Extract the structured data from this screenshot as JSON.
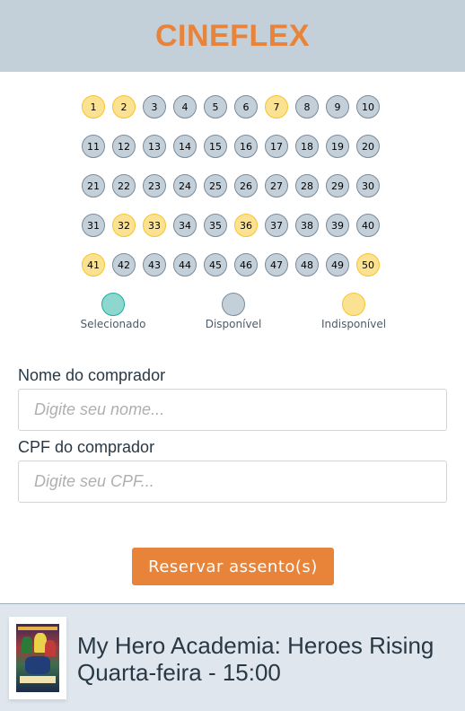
{
  "header": {
    "title": "CINEFLEX"
  },
  "seats": [
    {
      "number": "1",
      "status": "unavailable"
    },
    {
      "number": "2",
      "status": "unavailable"
    },
    {
      "number": "3",
      "status": "available"
    },
    {
      "number": "4",
      "status": "available"
    },
    {
      "number": "5",
      "status": "available"
    },
    {
      "number": "6",
      "status": "available"
    },
    {
      "number": "7",
      "status": "unavailable"
    },
    {
      "number": "8",
      "status": "available"
    },
    {
      "number": "9",
      "status": "available"
    },
    {
      "number": "10",
      "status": "available"
    },
    {
      "number": "11",
      "status": "available"
    },
    {
      "number": "12",
      "status": "available"
    },
    {
      "number": "13",
      "status": "available"
    },
    {
      "number": "14",
      "status": "available"
    },
    {
      "number": "15",
      "status": "available"
    },
    {
      "number": "16",
      "status": "available"
    },
    {
      "number": "17",
      "status": "available"
    },
    {
      "number": "18",
      "status": "available"
    },
    {
      "number": "19",
      "status": "available"
    },
    {
      "number": "20",
      "status": "available"
    },
    {
      "number": "21",
      "status": "available"
    },
    {
      "number": "22",
      "status": "available"
    },
    {
      "number": "23",
      "status": "available"
    },
    {
      "number": "24",
      "status": "available"
    },
    {
      "number": "25",
      "status": "available"
    },
    {
      "number": "26",
      "status": "available"
    },
    {
      "number": "27",
      "status": "available"
    },
    {
      "number": "28",
      "status": "available"
    },
    {
      "number": "29",
      "status": "available"
    },
    {
      "number": "30",
      "status": "available"
    },
    {
      "number": "31",
      "status": "available"
    },
    {
      "number": "32",
      "status": "unavailable"
    },
    {
      "number": "33",
      "status": "unavailable"
    },
    {
      "number": "34",
      "status": "available"
    },
    {
      "number": "35",
      "status": "available"
    },
    {
      "number": "36",
      "status": "unavailable"
    },
    {
      "number": "37",
      "status": "available"
    },
    {
      "number": "38",
      "status": "available"
    },
    {
      "number": "39",
      "status": "available"
    },
    {
      "number": "40",
      "status": "available"
    },
    {
      "number": "41",
      "status": "unavailable"
    },
    {
      "number": "42",
      "status": "available"
    },
    {
      "number": "43",
      "status": "available"
    },
    {
      "number": "44",
      "status": "available"
    },
    {
      "number": "45",
      "status": "available"
    },
    {
      "number": "46",
      "status": "available"
    },
    {
      "number": "47",
      "status": "available"
    },
    {
      "number": "48",
      "status": "available"
    },
    {
      "number": "49",
      "status": "available"
    },
    {
      "number": "50",
      "status": "unavailable"
    }
  ],
  "legend": {
    "selected": "Selecionado",
    "available": "Disponível",
    "unavailable": "Indisponível"
  },
  "form": {
    "name_label": "Nome do comprador",
    "name_placeholder": "Digite seu nome...",
    "cpf_label": "CPF do comprador",
    "cpf_placeholder": "Digite seu CPF...",
    "submit_label": "Reservar assento(s)"
  },
  "footer": {
    "movie_title": "My Hero Academia: Heroes Rising",
    "session": "Quarta-feira - 15:00"
  },
  "colors": {
    "accent": "#e8833a",
    "header_bg": "#c3cfd9",
    "available": "#c3cfd9",
    "unavailable": "#fbe192",
    "selected": "#1aae9e",
    "footer_bg": "#dfe6ed"
  }
}
